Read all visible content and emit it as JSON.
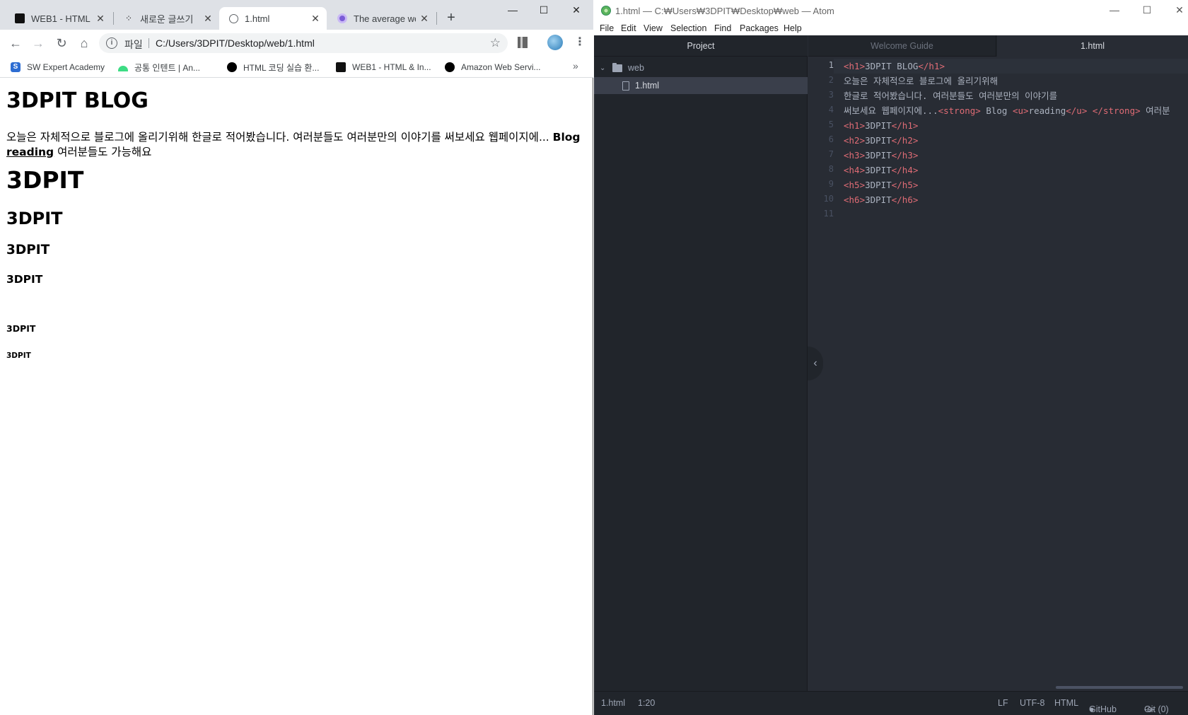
{
  "browser": {
    "tabs": [
      {
        "title": "WEB1 - HTML & ",
        "active": false
      },
      {
        "title": "새로운 글쓰기",
        "active": false
      },
      {
        "title": "1.html",
        "active": true
      },
      {
        "title": "The average we",
        "active": false
      }
    ],
    "new_tab": "+",
    "window_controls": {
      "minimize": "—",
      "maximize": "☐",
      "close": "✕"
    },
    "nav": {
      "back": "←",
      "forward": "→",
      "reload": "↻",
      "home": "⌂"
    },
    "address": {
      "scheme": "파일",
      "url": "C:/Users/3DPIT/Desktop/web/1.html",
      "info": "i"
    },
    "bookmarks": [
      {
        "label": "SW Expert Academy"
      },
      {
        "label": "공통 인텐트 | An..."
      },
      {
        "label": "HTML 코딩 실습 환..."
      },
      {
        "label": "WEB1 - HTML & In..."
      },
      {
        "label": "Amazon Web Servi..."
      }
    ],
    "bookmarks_more": "»",
    "page": {
      "h1": "3DPIT BLOG",
      "para_text": "오늘은 자체적으로 블로그에 올리기위해 한글로 적어봤습니다. 여러분들도 여러분만의 이야기를 써보세요 웹페이지에... ",
      "para_strong": "Blog",
      "para_underline": "reading",
      "para_tail": " 여러분들도 가능해요",
      "headings": [
        "3DPIT",
        "3DPIT",
        "3DPIT",
        "3DPIT",
        "3DPIT",
        "3DPIT"
      ]
    }
  },
  "atom": {
    "title": "1.html — C:₩Users₩3DPIT₩Desktop₩web — Atom",
    "window_controls": {
      "minimize": "—",
      "maximize": "☐",
      "close": "✕"
    },
    "menu": [
      "File",
      "Edit",
      "View",
      "Selection",
      "Find",
      "Packages",
      "Help"
    ],
    "tree": {
      "header": "Project",
      "folder": "web",
      "file": "1.html"
    },
    "tabs": [
      {
        "label": "Welcome Guide"
      },
      {
        "label": "1.html"
      }
    ],
    "collapse": "‹",
    "line_numbers": [
      "1",
      "2",
      "3",
      "4",
      "5",
      "6",
      "7",
      "8",
      "9",
      "10",
      "11"
    ],
    "code": {
      "l1_open": "<h1>",
      "l1_text": "3DPIT BLOG",
      "l1_close": "</h1>",
      "l2": "오늘은 자체적으로 블로그에 올리기위해",
      "l3": "한글로 적어봤습니다. 여러분들도 여러분만의 이야기를",
      "l4_a": "써보세요 웹페이지에...",
      "l4_strong_open": "<strong>",
      "l4_b": " Blog ",
      "l4_u_open": "<u>",
      "l4_c": "reading",
      "l4_u_close": "</u>",
      "l4_d": " ",
      "l4_strong_close": "</strong>",
      "l4_e": " 여러분",
      "heads": [
        {
          "open": "<h1>",
          "text": "3DPIT",
          "close": "</h1>"
        },
        {
          "open": "<h2>",
          "text": "3DPIT",
          "close": "</h2>"
        },
        {
          "open": "<h3>",
          "text": "3DPIT",
          "close": "</h3>"
        },
        {
          "open": "<h4>",
          "text": "3DPIT",
          "close": "</h4>"
        },
        {
          "open": "<h5>",
          "text": "3DPIT",
          "close": "</h5>"
        },
        {
          "open": "<h6>",
          "text": "3DPIT",
          "close": "</h6>"
        }
      ]
    },
    "status": {
      "file": "1.html",
      "cursor": "1:20",
      "line_ending": "LF",
      "encoding": "UTF-8",
      "grammar": "HTML",
      "github": "GitHub",
      "git": "Git (0)"
    }
  }
}
